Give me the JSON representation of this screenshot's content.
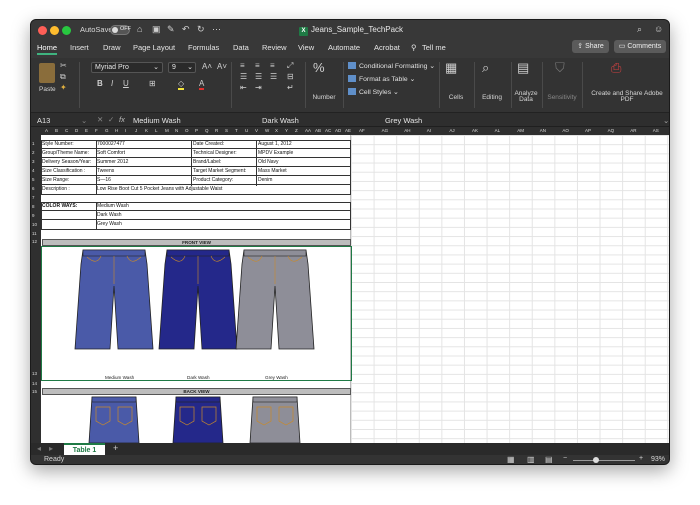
{
  "titlebar": {
    "autosave_label": "AutoSave",
    "autosave_state": "OFF",
    "doc_title": "Jeans_Sample_TechPack",
    "doc_icon": "excel-icon"
  },
  "tabs": [
    "Home",
    "Insert",
    "Draw",
    "Page Layout",
    "Formulas",
    "Data",
    "Review",
    "View",
    "Automate",
    "Acrobat",
    "Tell me"
  ],
  "active_tab": "Home",
  "share_label": "Share",
  "comments_label": "Comments",
  "ribbon": {
    "paste": "Paste",
    "font_name": "Myriad Pro",
    "font_size": "9",
    "number": "Number",
    "conditional_formatting": "Conditional Formatting",
    "format_as_table": "Format as Table",
    "cell_styles": "Cell Styles",
    "cells": "Cells",
    "editing": "Editing",
    "analyze_data": "Analyze Data",
    "sensitivity": "Sensitivity",
    "create_share": "Create and Share Adobe PDF"
  },
  "formula_bar": {
    "cell_ref": "A13",
    "fx": "fx",
    "content_1": "Medium Wash",
    "content_2": "Dark Wash",
    "content_3": "Grey Wash"
  },
  "columns_left": [
    "A",
    "B",
    "C",
    "D",
    "E",
    "F",
    "G",
    "H",
    "I",
    "J",
    "K",
    "L",
    "M",
    "N",
    "O",
    "P",
    "Q",
    "R",
    "S",
    "T",
    "U",
    "V",
    "W",
    "X",
    "Y",
    "Z",
    "AA",
    "AB",
    "AC",
    "AD",
    "AE"
  ],
  "columns_right": [
    "AF",
    "AG",
    "AH",
    "AI",
    "AJ",
    "AK",
    "AL",
    "AM",
    "AN",
    "AO",
    "AP",
    "AQ",
    "AR",
    "AS"
  ],
  "rows": [
    "1",
    "2",
    "3",
    "4",
    "5",
    "6",
    "7",
    "8",
    "9",
    "10",
    "11",
    "12",
    "13",
    "14",
    "15"
  ],
  "form": {
    "style_number_label": "Style Number:",
    "style_number": "7000027477",
    "group_label": "Group/Theme Name:",
    "group": "Soft Comfort",
    "delivery_label": "Delivery Season/Year:",
    "delivery": "Summer 2012",
    "size_class_label": "Size Classification :",
    "size_class": "Tweens",
    "size_range_label": "Size Range:",
    "size_range": "S—16",
    "description_label": "Description :",
    "description": "Low Rise Boot Cut 5 Pocket Jeans with Adjustable Waist",
    "date_label": "Date Created:",
    "date": "August 1, 2012",
    "designer_label": "Technical Designer:",
    "designer": "MPDV Example",
    "brand_label": "Brand/Label:",
    "brand": "Old Navy",
    "market_label": "Target Market Segment:",
    "market": "Mass Market",
    "category_label": "Product Category:",
    "category": "Denim",
    "colorways_label": "COLOR WAYS:",
    "colorways": [
      "Medium Wash",
      "Dark Wash",
      "Grey Wash"
    ],
    "front_view": "FRONT VIEW",
    "back_view": "BACK VIEW",
    "captions": [
      "Medium Wash",
      "Dark Wash",
      "Grey Wash"
    ]
  },
  "jean_colors": [
    "#4a5aa8",
    "#24288a",
    "#8e8e98"
  ],
  "sheet_tab": "Table 1",
  "status": "Ready",
  "zoom": "93%"
}
